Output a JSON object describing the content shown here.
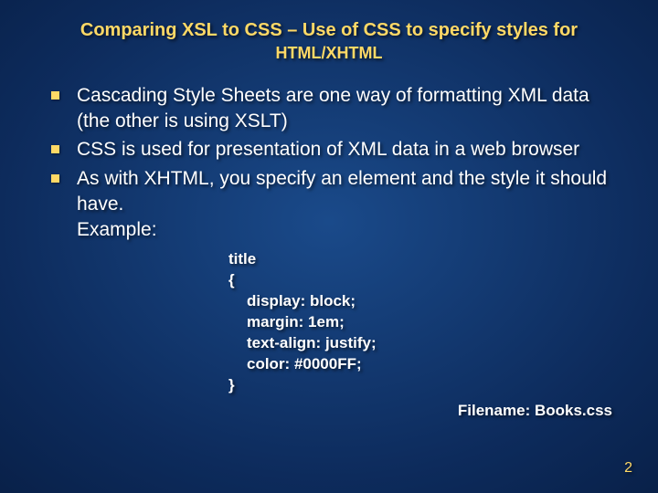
{
  "title_line1": "Comparing XSL to CSS – Use of CSS to specify styles for",
  "title_line2": "HTML/XHTML",
  "bullets": [
    "Cascading Style Sheets are one way of formatting XML data (the other is using XSLT)",
    "CSS is used for presentation of XML data in a web browser",
    "As with XHTML, you specify an element and the style it should have.\nExample:"
  ],
  "code": {
    "l1": "title",
    "l2": "{",
    "l3": "display: block;",
    "l4": "margin: 1em;",
    "l5": "text-align: justify;",
    "l6": "color: #0000FF;",
    "l7": "}"
  },
  "filename": "Filename: Books.css",
  "page": "2"
}
